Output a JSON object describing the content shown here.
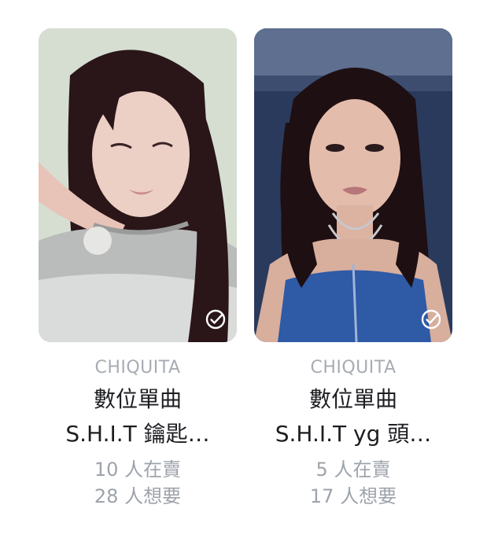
{
  "cards": [
    {
      "brand": "CHIQUITA",
      "title_line1": "數位單曲",
      "title_line2": "S.H.I.T 鑰匙…",
      "selling": "10 人在賣",
      "wanting": "28 人想要",
      "selected": true,
      "photo_palette": {
        "bg": "#c9d3c4",
        "hair": "#2a1518",
        "skin": "#e8c8bd",
        "top": "#b9b9b9"
      }
    },
    {
      "brand": "CHIQUITA",
      "title_line1": "數位單曲",
      "title_line2": "S.H.I.T yg 頭…",
      "selling": "5 人在賣",
      "wanting": "17 人想要",
      "selected": true,
      "photo_palette": {
        "bg": "#23314f",
        "hair": "#1e0f12",
        "skin": "#e2b8a6",
        "top": "#2f5aa6"
      }
    }
  ]
}
